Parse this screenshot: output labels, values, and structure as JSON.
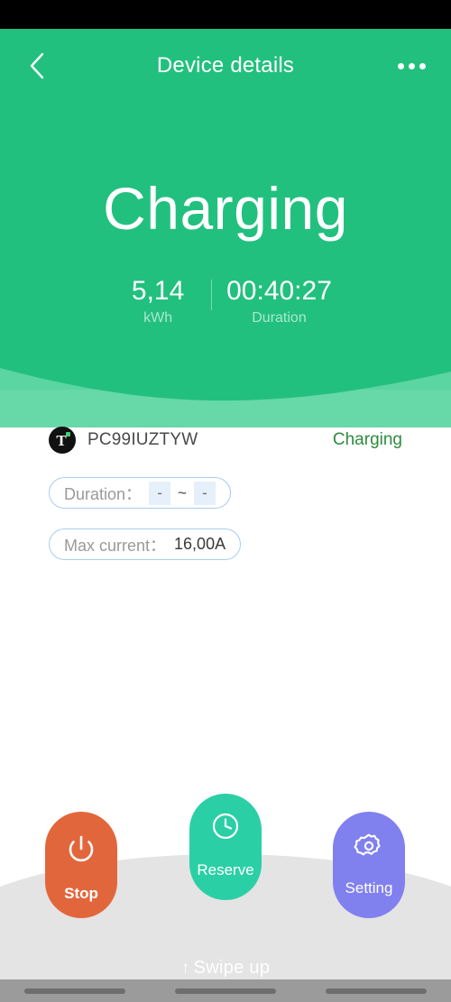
{
  "appbar": {
    "title": "Device details",
    "back_icon": "chevron-left-icon",
    "more_icon": "overflow-menu-icon"
  },
  "hero": {
    "state": "Charging",
    "stats": [
      {
        "value": "5,14",
        "label": "kWh"
      },
      {
        "value": "00:40:27",
        "label": "Duration"
      }
    ]
  },
  "device": {
    "icon": "tesla-t-icon",
    "name": "PC99IUZTYW",
    "status": "Charging",
    "status_color": "#2E8B3E"
  },
  "chips": {
    "duration": {
      "label": "Duration：",
      "start": "-",
      "separator": "~",
      "end": "-"
    },
    "max_current": {
      "label": "Max current：",
      "value": "16,00A"
    }
  },
  "actions": [
    {
      "label": "Stop",
      "icon": "power-icon",
      "color": "#E2663C"
    },
    {
      "label": "Reserve",
      "icon": "clock-icon",
      "color": "#2BCFA5"
    },
    {
      "label": "Setting",
      "icon": "gear-icon",
      "color": "#8080EE"
    }
  ],
  "swipe": {
    "arrow": "↑",
    "text": "Swipe up"
  },
  "theme": {
    "brand_green": "#22C07E",
    "wave_light": "#5FD6A3",
    "panel_gray": "#E4E4E4",
    "chip_border": "#A9CCEC",
    "chip_box": "#E6F0FA"
  }
}
